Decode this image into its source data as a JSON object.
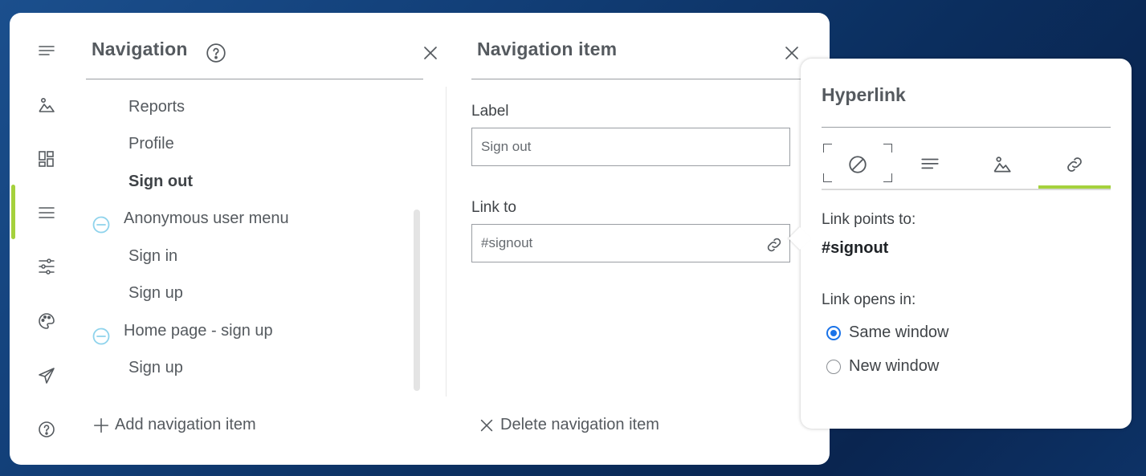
{
  "navigation": {
    "title": "Navigation",
    "items": [
      {
        "label": "Reports",
        "bold": false
      },
      {
        "label": "Profile",
        "bold": false
      },
      {
        "label": "Sign out",
        "bold": true
      }
    ],
    "groups": [
      {
        "label": "Anonymous user menu",
        "icon": "collapse-icon",
        "children": [
          "Sign in",
          "Sign up"
        ]
      },
      {
        "label": "Home page - sign up",
        "icon": "collapse-icon",
        "children": [
          "Sign up"
        ]
      }
    ],
    "add_label": "Add navigation item"
  },
  "rail": {
    "icons": [
      "menu-icon",
      "image-icon",
      "layout-icon",
      "navigation-icon",
      "settings-sliders-icon",
      "palette-icon",
      "send-icon",
      "help-icon"
    ],
    "active": "navigation-icon",
    "accent": "#a5d13c"
  },
  "nav_item": {
    "title": "Navigation item",
    "label_caption": "Label",
    "label_value": "Sign out",
    "link_caption": "Link to",
    "link_value": "#signout",
    "delete_label": "Delete navigation item"
  },
  "hyperlink": {
    "title": "Hyperlink",
    "tabs": [
      "no-link-icon",
      "text-icon",
      "image-icon",
      "link-icon"
    ],
    "active_tab": "link-icon",
    "points_to_caption": "Link points to:",
    "points_to_value": "#signout",
    "opens_in_caption": "Link opens in:",
    "options": [
      {
        "label": "Same window",
        "checked": true
      },
      {
        "label": "New window",
        "checked": false
      }
    ]
  },
  "colors": {
    "accent": "#a5d13c",
    "radio": "#1a73e8",
    "collapse": "#8fd3ec"
  }
}
